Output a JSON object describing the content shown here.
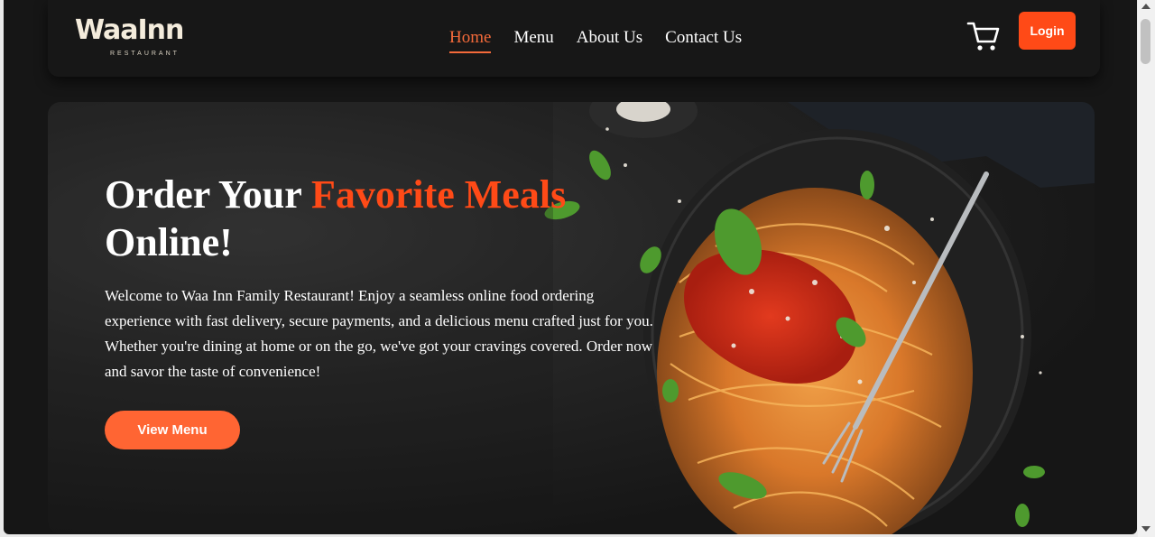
{
  "brand": {
    "name": "WaaInn",
    "tagline": "RESTAURANT"
  },
  "nav": {
    "items": [
      {
        "label": "Home",
        "active": true
      },
      {
        "label": "Menu",
        "active": false
      },
      {
        "label": "About Us",
        "active": false
      },
      {
        "label": "Contact Us",
        "active": false
      }
    ]
  },
  "header": {
    "cart_icon": "cart-icon",
    "login_label": "Login"
  },
  "hero": {
    "title_pre": "Order Your ",
    "title_accent": "Favorite Meals",
    "title_post": "Online!",
    "description": "Welcome to Waa Inn Family Restaurant! Enjoy a seamless online food ordering experience with fast delivery, secure payments, and a delicious menu crafted just for you. Whether you're dining at home or on the go, we've got your cravings covered. Order now and savor the taste of convenience!",
    "cta_label": "View Menu",
    "image": "spaghetti-plate-image"
  },
  "colors": {
    "accent": "#ff4a17",
    "cta": "#ff6533",
    "nav_active": "#f46a3a",
    "background": "#161616"
  }
}
